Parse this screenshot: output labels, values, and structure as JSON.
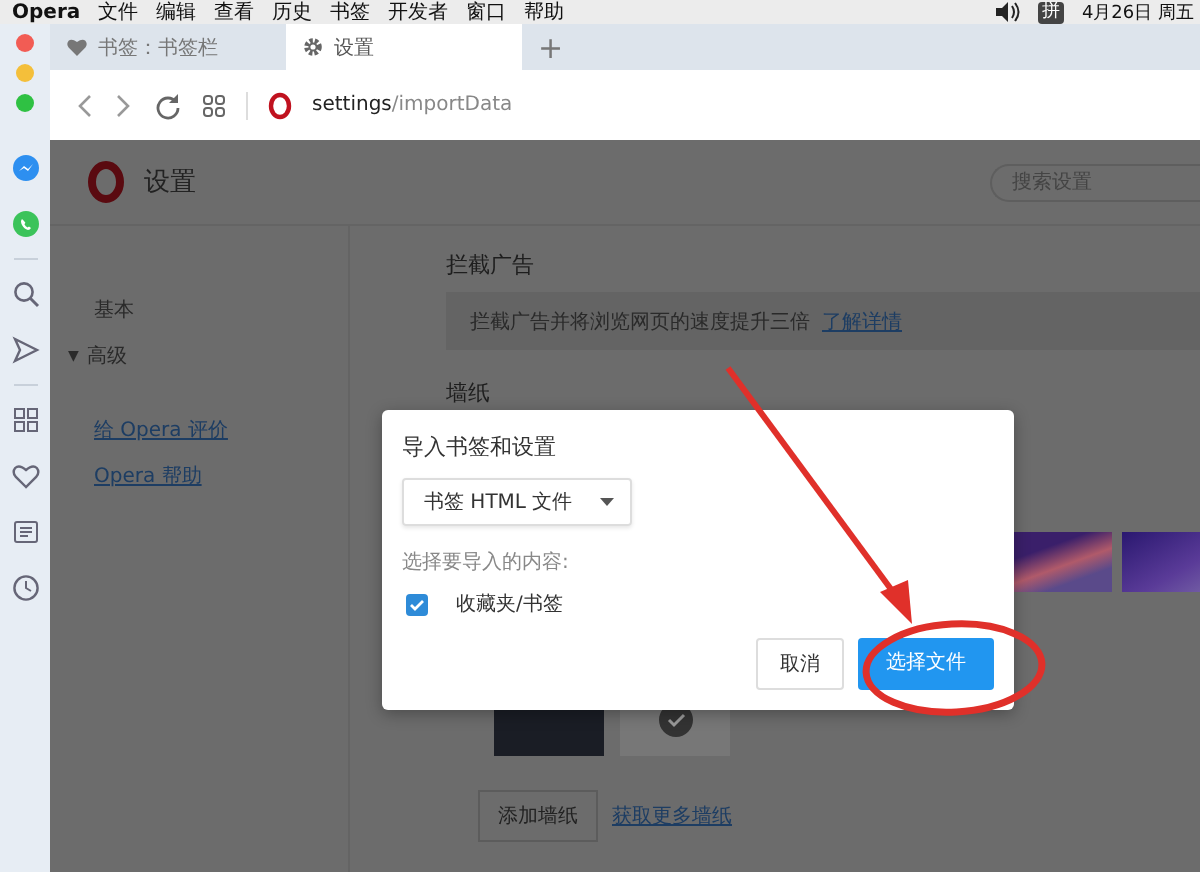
{
  "menubar": {
    "app": "Opera",
    "menus": [
      "文件",
      "编辑",
      "查看",
      "历史",
      "书签",
      "开发者",
      "窗口",
      "帮助"
    ],
    "input_method": "拼",
    "clock": "4月26日 周五"
  },
  "tabs": [
    {
      "label": "书签：书签栏",
      "selected": false,
      "kind": "bookmarks"
    },
    {
      "label": "设置",
      "selected": true,
      "kind": "settings"
    }
  ],
  "new_tab": "+",
  "address_bar": {
    "url_host": "settings",
    "url_path": "/importData"
  },
  "settings": {
    "title": "设置",
    "search": {
      "placeholder": "搜索设置"
    },
    "nav": [
      {
        "label": "基本",
        "kind": "item"
      },
      {
        "label": "高级",
        "kind": "group",
        "expanded": true,
        "caret": "▼"
      },
      {
        "label": "给 Opera 评价",
        "kind": "link"
      },
      {
        "label": "Opera 帮助",
        "kind": "link"
      }
    ],
    "ad_block": {
      "heading": "拦截广告",
      "text": "拦截广告并将浏览网页的速度提升三倍",
      "link": "了解详情"
    },
    "wallpaper": {
      "heading": "墙纸",
      "rows": [
        {
          "items": [
            {
              "kind": "wave",
              "selected": false
            },
            {
              "kind": "clouds",
              "selected": false
            }
          ]
        },
        {
          "items": [
            {
              "kind": "dark",
              "selected": false
            },
            {
              "kind": "plain",
              "selected": true
            }
          ]
        }
      ],
      "add_button": "添加墙纸",
      "more_link": "获取更多墙纸"
    }
  },
  "dialog": {
    "title": "导入书签和设置",
    "source": "书签 HTML 文件",
    "prompt": "选择要导入的内容:",
    "options": [
      {
        "label": "收藏夹/书签",
        "checked": true
      }
    ],
    "buttons": [
      {
        "label": "取消",
        "kind": "secondary"
      },
      {
        "label": "选择文件",
        "kind": "primary"
      }
    ]
  }
}
